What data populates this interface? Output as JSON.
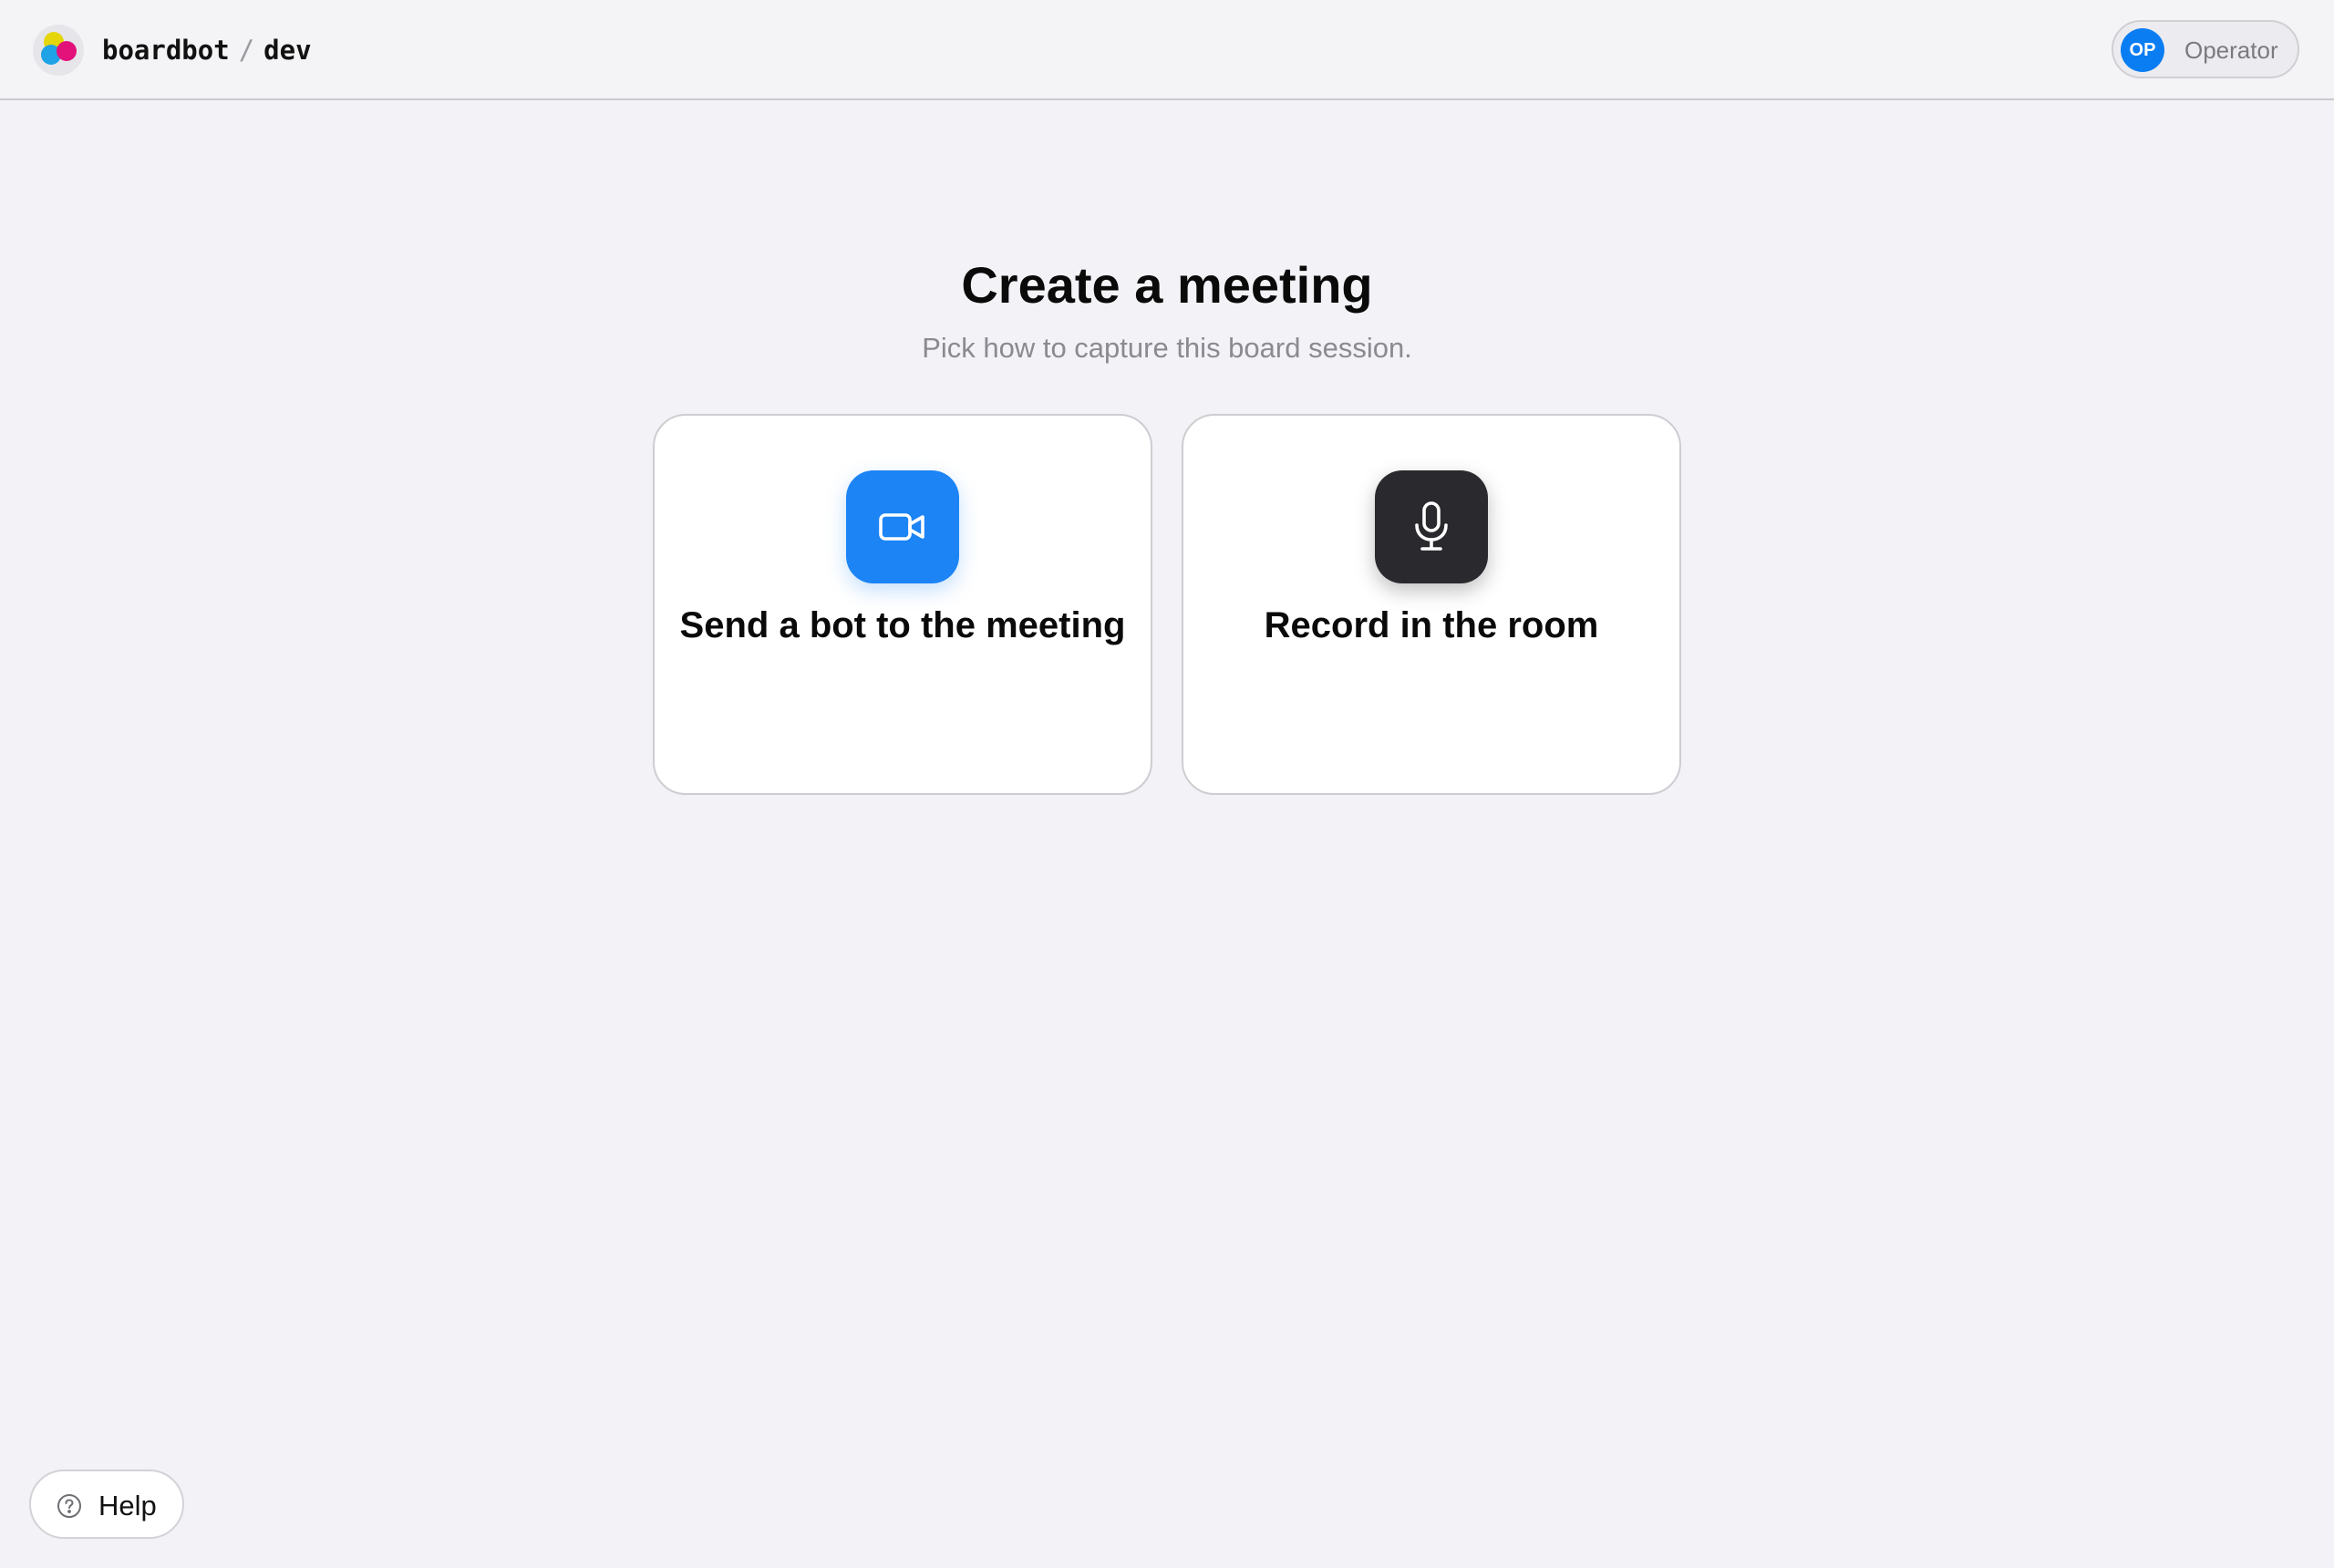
{
  "header": {
    "app_name": "boardbot",
    "separator": "/",
    "environment": "dev",
    "user": {
      "initials": "OP",
      "name": "Operator",
      "avatar_color": "#0a7df2"
    }
  },
  "main": {
    "title": "Create a meeting",
    "subtitle": "Pick how to capture this board session.",
    "options": [
      {
        "label": "Send a bot to the meeting",
        "icon": "video-camera-icon",
        "icon_bg": "#1c84f5"
      },
      {
        "label": "Record in the room",
        "icon": "microphone-icon",
        "icon_bg": "#2a2a2e"
      }
    ]
  },
  "help": {
    "label": "Help",
    "icon": "question-circle-icon"
  }
}
